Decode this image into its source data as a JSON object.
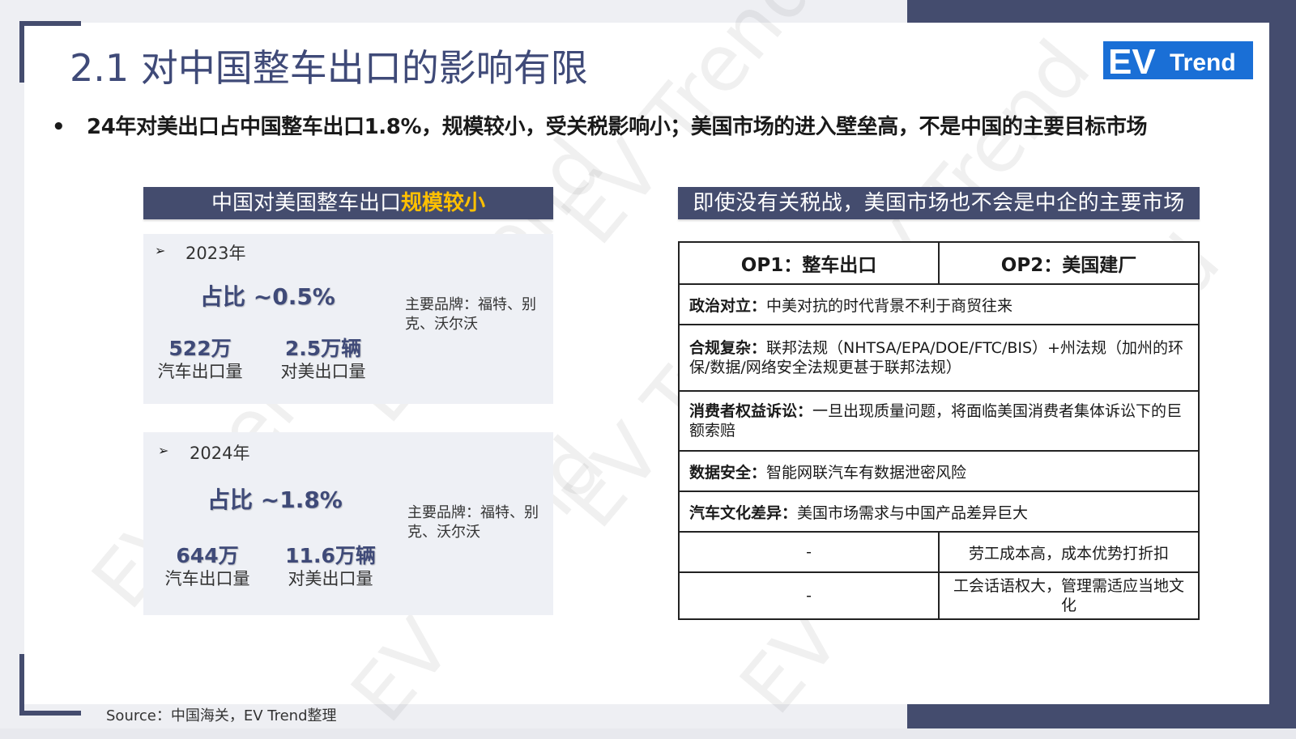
{
  "slide": {
    "title": "2.1 对中国整车出口的影响有限",
    "bullet": "24年对美出口占中国整车出口1.8%，规模较小，受关税影响小；美国市场的进入壁垒高，不是中国的主要目标市场",
    "logo": {
      "ev": "EV",
      "trend": "Trend",
      "color": "#1a6fd6"
    },
    "source": "Source：中国海关，EV Trend整理"
  },
  "left": {
    "header_prefix": "中国对美国整车出口",
    "header_highlight": "规模较小",
    "panels": [
      {
        "arrow": "➢",
        "year": "2023年",
        "share": "占比 ~0.5%",
        "total": "522万",
        "total_label": "汽车出口量",
        "us": "2.5万辆",
        "us_label": "对美出口量",
        "brands": "主要品牌：福特、别克、沃尔沃"
      },
      {
        "arrow": "➢",
        "year": "2024年",
        "share": "占比 ~1.8%",
        "total": "644万",
        "total_label": "汽车出口量",
        "us": "11.6万辆",
        "us_label": "对美出口量",
        "brands": "主要品牌：福特、别克、沃尔沃"
      }
    ]
  },
  "right": {
    "header": "即使没有关税战，美国市场也不会是中企的主要市场",
    "col1": "OP1：整车出口",
    "col2": "OP2：美国建厂",
    "rows": [
      {
        "label": "政治对立：",
        "text": "中美对抗的时代背景不利于商贸往来"
      },
      {
        "label": "合规复杂：",
        "text": "联邦法规（NHTSA/EPA/DOE/FTC/BIS）+州法规（加州的环保/数据/网络安全法规更甚于联邦法规）"
      },
      {
        "label": "消费者权益诉讼：",
        "text": "一旦出现质量问题，将面临美国消费者集体诉讼下的巨额索赔"
      },
      {
        "label": "数据安全：",
        "text": "智能网联汽车有数据泄密风险"
      },
      {
        "label": "汽车文化差异：",
        "text": "美国市场需求与中国产品差异巨大"
      }
    ],
    "split_rows": [
      {
        "op1": "-",
        "op2": "劳工成本高，成本优势打折扣"
      },
      {
        "op1": "-",
        "op2": "工会话语权大，管理需适应当地文化"
      }
    ]
  },
  "watermark": "EV Trend"
}
